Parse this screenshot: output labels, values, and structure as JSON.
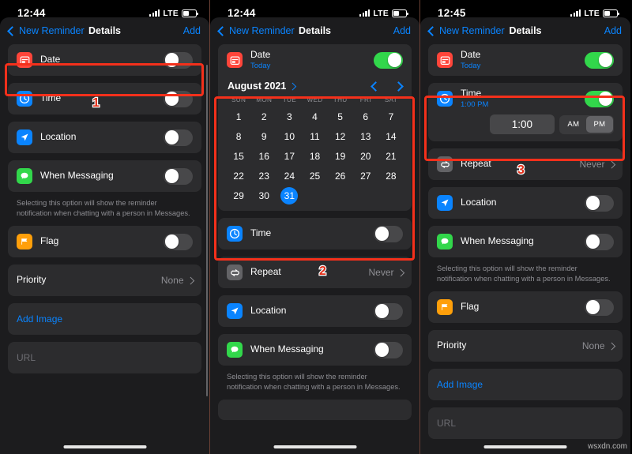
{
  "panels": [
    {
      "status": {
        "time": "12:44",
        "network": "LTE"
      },
      "nav": {
        "back": "New Reminder",
        "title": "Details",
        "add": "Add"
      },
      "rows": [
        {
          "name": "date",
          "icon": "calendar-icon",
          "label": "Date",
          "sub": "",
          "control": "toggle",
          "on": false
        },
        {
          "name": "time",
          "icon": "clock-icon",
          "label": "Time",
          "sub": "",
          "control": "toggle",
          "on": false
        },
        {
          "name": "location",
          "icon": "location-icon",
          "label": "Location",
          "sub": "",
          "control": "toggle",
          "on": false
        },
        {
          "name": "when-messaging",
          "icon": "message-icon",
          "label": "When Messaging",
          "sub": "",
          "control": "toggle",
          "on": false
        },
        {
          "name": "flag",
          "icon": "flag-icon",
          "label": "Flag",
          "sub": "",
          "control": "toggle",
          "on": false
        },
        {
          "name": "priority",
          "icon": "",
          "label": "Priority",
          "sub": "",
          "control": "value",
          "value": "None"
        },
        {
          "name": "add-image",
          "icon": "",
          "label": "Add Image",
          "sub": "",
          "control": "link"
        },
        {
          "name": "url",
          "icon": "",
          "label": "URL",
          "sub": "",
          "control": "placeholder"
        }
      ],
      "note": "Selecting this option will show the reminder notification when chatting with a person in Messages.",
      "marker": "1"
    },
    {
      "status": {
        "time": "12:44",
        "network": "LTE"
      },
      "nav": {
        "back": "New Reminder",
        "title": "Details",
        "add": "Add"
      },
      "rows": [
        {
          "name": "date",
          "icon": "calendar-icon",
          "label": "Date",
          "sub": "Today",
          "control": "toggle",
          "on": true
        },
        {
          "name": "time",
          "icon": "clock-icon",
          "label": "Time",
          "sub": "",
          "control": "toggle",
          "on": false
        },
        {
          "name": "repeat",
          "icon": "repeat-icon",
          "label": "Repeat",
          "sub": "",
          "control": "value",
          "value": "Never"
        },
        {
          "name": "location",
          "icon": "location-icon",
          "label": "Location",
          "sub": "",
          "control": "toggle",
          "on": false
        },
        {
          "name": "when-messaging",
          "icon": "message-icon",
          "label": "When Messaging",
          "sub": "",
          "control": "toggle",
          "on": false
        }
      ],
      "note": "Selecting this option will show the reminder notification when chatting with a person in Messages.",
      "marker": "2"
    },
    {
      "status": {
        "time": "12:45",
        "network": "LTE"
      },
      "nav": {
        "back": "New Reminder",
        "title": "Details",
        "add": "Add"
      },
      "rows": [
        {
          "name": "date",
          "icon": "calendar-icon",
          "label": "Date",
          "sub": "Today",
          "control": "toggle",
          "on": true
        },
        {
          "name": "time",
          "icon": "clock-icon",
          "label": "Time",
          "sub": "1:00 PM",
          "control": "toggle",
          "on": true
        },
        {
          "name": "repeat",
          "icon": "repeat-icon",
          "label": "Repeat",
          "sub": "",
          "control": "value",
          "value": "Never"
        },
        {
          "name": "location",
          "icon": "location-icon",
          "label": "Location",
          "sub": "",
          "control": "toggle",
          "on": false
        },
        {
          "name": "when-messaging",
          "icon": "message-icon",
          "label": "When Messaging",
          "sub": "",
          "control": "toggle",
          "on": false
        },
        {
          "name": "flag",
          "icon": "flag-icon",
          "label": "Flag",
          "sub": "",
          "control": "toggle",
          "on": false
        },
        {
          "name": "priority",
          "icon": "",
          "label": "Priority",
          "sub": "",
          "control": "value",
          "value": "None"
        },
        {
          "name": "add-image",
          "icon": "",
          "label": "Add Image",
          "sub": "",
          "control": "link"
        },
        {
          "name": "url",
          "icon": "",
          "label": "URL",
          "sub": "",
          "control": "placeholder"
        }
      ],
      "note": "Selecting this option will show the reminder notification when chatting with a person in Messages.",
      "marker": "3"
    }
  ],
  "calendar": {
    "month_label": "August 2021",
    "dow": [
      "SUN",
      "MON",
      "TUE",
      "WED",
      "THU",
      "FRI",
      "SAT"
    ],
    "days": [
      1,
      2,
      3,
      4,
      5,
      6,
      7,
      8,
      9,
      10,
      11,
      12,
      13,
      14,
      15,
      16,
      17,
      18,
      19,
      20,
      21,
      22,
      23,
      24,
      25,
      26,
      27,
      28,
      29,
      30,
      31
    ],
    "selected_day": 31,
    "prev_label": "previous-month",
    "next_label": "next-month"
  },
  "time_picker": {
    "value": "1:00",
    "am_label": "AM",
    "pm_label": "PM",
    "selected": "PM"
  },
  "watermark": "wsxdn.com",
  "colors": {
    "accent_blue": "#0a84ff",
    "toggle_on": "#32d74b",
    "toggle_off": "#48484a",
    "date_icon": "#ff453a",
    "time_icon": "#0a84ff",
    "location_icon": "#0a84ff",
    "message_icon": "#32d74b",
    "flag_icon": "#ff9f0a",
    "repeat_icon": "#636366",
    "highlight_box": "#f4301b",
    "card_bg": "#2c2c2e",
    "sheet_bg": "#1c1c1e"
  }
}
